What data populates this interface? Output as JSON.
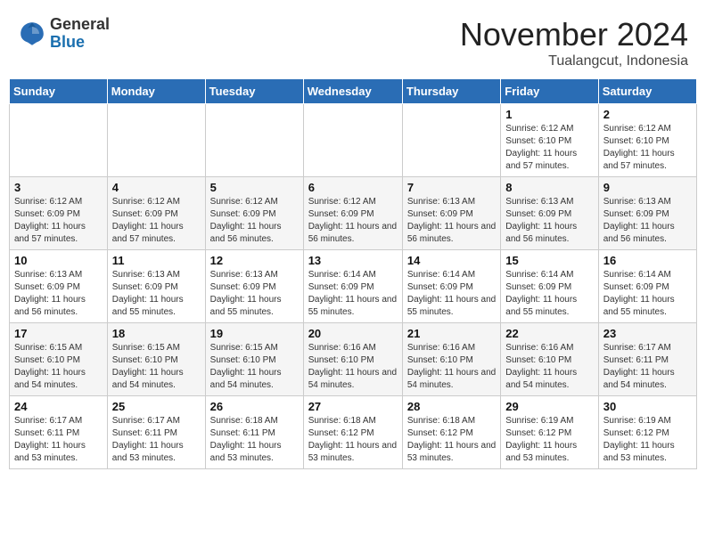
{
  "header": {
    "logo_general": "General",
    "logo_blue": "Blue",
    "month_title": "November 2024",
    "location": "Tualangcut, Indonesia"
  },
  "days_of_week": [
    "Sunday",
    "Monday",
    "Tuesday",
    "Wednesday",
    "Thursday",
    "Friday",
    "Saturday"
  ],
  "weeks": [
    [
      {
        "day": "",
        "info": ""
      },
      {
        "day": "",
        "info": ""
      },
      {
        "day": "",
        "info": ""
      },
      {
        "day": "",
        "info": ""
      },
      {
        "day": "",
        "info": ""
      },
      {
        "day": "1",
        "info": "Sunrise: 6:12 AM\nSunset: 6:10 PM\nDaylight: 11 hours and 57 minutes."
      },
      {
        "day": "2",
        "info": "Sunrise: 6:12 AM\nSunset: 6:10 PM\nDaylight: 11 hours and 57 minutes."
      }
    ],
    [
      {
        "day": "3",
        "info": "Sunrise: 6:12 AM\nSunset: 6:09 PM\nDaylight: 11 hours and 57 minutes."
      },
      {
        "day": "4",
        "info": "Sunrise: 6:12 AM\nSunset: 6:09 PM\nDaylight: 11 hours and 57 minutes."
      },
      {
        "day": "5",
        "info": "Sunrise: 6:12 AM\nSunset: 6:09 PM\nDaylight: 11 hours and 56 minutes."
      },
      {
        "day": "6",
        "info": "Sunrise: 6:12 AM\nSunset: 6:09 PM\nDaylight: 11 hours and 56 minutes."
      },
      {
        "day": "7",
        "info": "Sunrise: 6:13 AM\nSunset: 6:09 PM\nDaylight: 11 hours and 56 minutes."
      },
      {
        "day": "8",
        "info": "Sunrise: 6:13 AM\nSunset: 6:09 PM\nDaylight: 11 hours and 56 minutes."
      },
      {
        "day": "9",
        "info": "Sunrise: 6:13 AM\nSunset: 6:09 PM\nDaylight: 11 hours and 56 minutes."
      }
    ],
    [
      {
        "day": "10",
        "info": "Sunrise: 6:13 AM\nSunset: 6:09 PM\nDaylight: 11 hours and 56 minutes."
      },
      {
        "day": "11",
        "info": "Sunrise: 6:13 AM\nSunset: 6:09 PM\nDaylight: 11 hours and 55 minutes."
      },
      {
        "day": "12",
        "info": "Sunrise: 6:13 AM\nSunset: 6:09 PM\nDaylight: 11 hours and 55 minutes."
      },
      {
        "day": "13",
        "info": "Sunrise: 6:14 AM\nSunset: 6:09 PM\nDaylight: 11 hours and 55 minutes."
      },
      {
        "day": "14",
        "info": "Sunrise: 6:14 AM\nSunset: 6:09 PM\nDaylight: 11 hours and 55 minutes."
      },
      {
        "day": "15",
        "info": "Sunrise: 6:14 AM\nSunset: 6:09 PM\nDaylight: 11 hours and 55 minutes."
      },
      {
        "day": "16",
        "info": "Sunrise: 6:14 AM\nSunset: 6:09 PM\nDaylight: 11 hours and 55 minutes."
      }
    ],
    [
      {
        "day": "17",
        "info": "Sunrise: 6:15 AM\nSunset: 6:10 PM\nDaylight: 11 hours and 54 minutes."
      },
      {
        "day": "18",
        "info": "Sunrise: 6:15 AM\nSunset: 6:10 PM\nDaylight: 11 hours and 54 minutes."
      },
      {
        "day": "19",
        "info": "Sunrise: 6:15 AM\nSunset: 6:10 PM\nDaylight: 11 hours and 54 minutes."
      },
      {
        "day": "20",
        "info": "Sunrise: 6:16 AM\nSunset: 6:10 PM\nDaylight: 11 hours and 54 minutes."
      },
      {
        "day": "21",
        "info": "Sunrise: 6:16 AM\nSunset: 6:10 PM\nDaylight: 11 hours and 54 minutes."
      },
      {
        "day": "22",
        "info": "Sunrise: 6:16 AM\nSunset: 6:10 PM\nDaylight: 11 hours and 54 minutes."
      },
      {
        "day": "23",
        "info": "Sunrise: 6:17 AM\nSunset: 6:11 PM\nDaylight: 11 hours and 54 minutes."
      }
    ],
    [
      {
        "day": "24",
        "info": "Sunrise: 6:17 AM\nSunset: 6:11 PM\nDaylight: 11 hours and 53 minutes."
      },
      {
        "day": "25",
        "info": "Sunrise: 6:17 AM\nSunset: 6:11 PM\nDaylight: 11 hours and 53 minutes."
      },
      {
        "day": "26",
        "info": "Sunrise: 6:18 AM\nSunset: 6:11 PM\nDaylight: 11 hours and 53 minutes."
      },
      {
        "day": "27",
        "info": "Sunrise: 6:18 AM\nSunset: 6:12 PM\nDaylight: 11 hours and 53 minutes."
      },
      {
        "day": "28",
        "info": "Sunrise: 6:18 AM\nSunset: 6:12 PM\nDaylight: 11 hours and 53 minutes."
      },
      {
        "day": "29",
        "info": "Sunrise: 6:19 AM\nSunset: 6:12 PM\nDaylight: 11 hours and 53 minutes."
      },
      {
        "day": "30",
        "info": "Sunrise: 6:19 AM\nSunset: 6:12 PM\nDaylight: 11 hours and 53 minutes."
      }
    ]
  ]
}
